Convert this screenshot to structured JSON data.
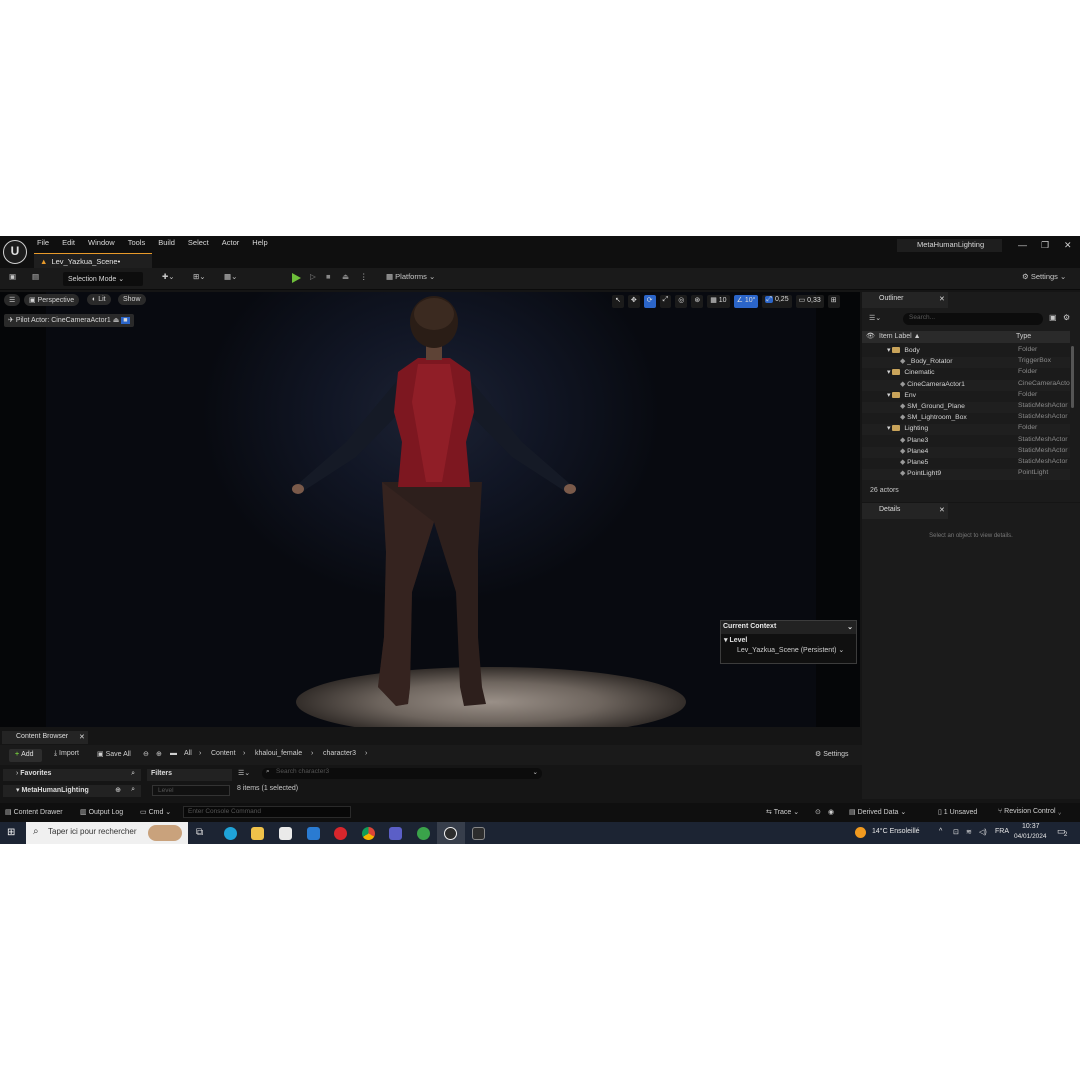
{
  "menu": {
    "items": [
      "File",
      "Edit",
      "Window",
      "Tools",
      "Build",
      "Select",
      "Actor",
      "Help"
    ],
    "tab_title": "Lev_Yazkua_Scene•",
    "project_name": "MetaHumanLighting"
  },
  "toolbar": {
    "selection_mode": "Selection Mode",
    "platforms": "Platforms",
    "settings": "Settings"
  },
  "viewport": {
    "perspective": "Perspective",
    "lit": "Lit",
    "show": "Show",
    "pilot_actor": "Pilot Actor: CineCameraActor1",
    "grid_size": "10",
    "rotation_snap": "10°",
    "scale_snap": "0,25",
    "camera_speed": "0,33"
  },
  "context": {
    "header": "Current Context",
    "level_label": "Level",
    "level_value": "Lev_Yazkua_Scene (Persistent)"
  },
  "outliner": {
    "tab": "Outliner",
    "search_placeholder": "Search...",
    "col_label": "Item Label ▲",
    "col_type": "Type",
    "rows": [
      {
        "label": "Body",
        "type": "Folder"
      },
      {
        "label": "_Body_Rotator",
        "type": "TriggerBox"
      },
      {
        "label": "Cinematic",
        "type": "Folder"
      },
      {
        "label": "CineCameraActor1",
        "type": "CineCameraActor"
      },
      {
        "label": "Env",
        "type": "Folder"
      },
      {
        "label": "SM_Ground_Plane",
        "type": "StaticMeshActor"
      },
      {
        "label": "SM_Lightroom_Box",
        "type": "StaticMeshActor"
      },
      {
        "label": "Lighting",
        "type": "Folder"
      },
      {
        "label": "Plane3",
        "type": "StaticMeshActor"
      },
      {
        "label": "Plane4",
        "type": "StaticMeshActor"
      },
      {
        "label": "Plane5",
        "type": "StaticMeshActor"
      },
      {
        "label": "PointLight9",
        "type": "PointLight"
      }
    ],
    "actor_count": "26 actors"
  },
  "details": {
    "tab": "Details",
    "empty_message": "Select an object to view details."
  },
  "content_browser": {
    "tab": "Content Browser",
    "add": "Add",
    "import": "Import",
    "save_all": "Save All",
    "breadcrumb": [
      "All",
      "Content",
      "khaloui_female",
      "character3"
    ],
    "settings": "Settings",
    "favorites": "Favorites",
    "metahumans": "MetaHumanLighting",
    "filters": "Filters",
    "level_filter": "Level",
    "search_placeholder": "Search character3",
    "items_count": "8 items (1 selected)"
  },
  "statusbar": {
    "content_drawer": "Content Drawer",
    "output_log": "Output Log",
    "cmd": "Cmd",
    "console_placeholder": "Enter Console Command",
    "trace": "Trace",
    "derived_data": "Derived Data",
    "unsaved": "1 Unsaved",
    "revision_control": "Revision Control"
  },
  "taskbar": {
    "search_placeholder": "Taper ici pour rechercher",
    "weather": "14°C  Ensoleillé",
    "language": "FRA",
    "time": "10:37",
    "date": "04/01/2024",
    "notifications": "2"
  }
}
